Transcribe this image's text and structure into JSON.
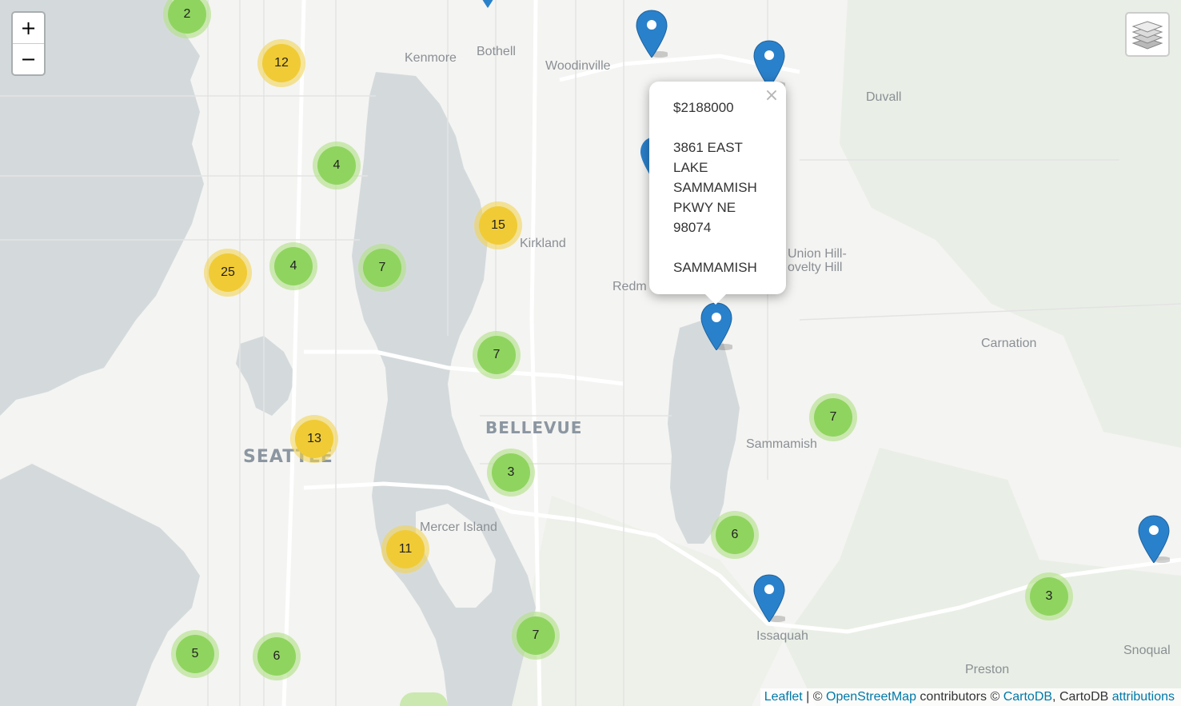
{
  "controls": {
    "zoom_in": "+",
    "zoom_out": "−",
    "layers_icon": "layers-icon"
  },
  "place_labels": {
    "kenmore": "Kenmore",
    "bothell": "Bothell",
    "woodinville": "Woodinville",
    "duvall": "Duvall",
    "kirkland": "Kirkland",
    "redmond": "Redm",
    "union_hill": "Union Hill-",
    "novelty_hill": "ovelty Hill",
    "carnation": "Carnation",
    "bellevue": "BELLEVUE",
    "seattle": "SEATTLE",
    "sammamish": "Sammamish",
    "mercer_island": "Mercer Island",
    "issaquah": "Issaquah",
    "preston": "Preston",
    "snoqualmie": "Snoqual"
  },
  "clusters": [
    {
      "count": "2",
      "level": "green"
    },
    {
      "count": "12",
      "level": "yellow"
    },
    {
      "count": "4",
      "level": "green"
    },
    {
      "count": "15",
      "level": "yellow"
    },
    {
      "count": "25",
      "level": "yellow"
    },
    {
      "count": "4",
      "level": "green"
    },
    {
      "count": "7",
      "level": "green"
    },
    {
      "count": "7",
      "level": "green"
    },
    {
      "count": "7",
      "level": "green"
    },
    {
      "count": "13",
      "level": "yellow"
    },
    {
      "count": "3",
      "level": "green"
    },
    {
      "count": "6",
      "level": "green"
    },
    {
      "count": "11",
      "level": "yellow"
    },
    {
      "count": "3",
      "level": "green"
    },
    {
      "count": "5",
      "level": "green"
    },
    {
      "count": "6",
      "level": "green"
    },
    {
      "count": "7",
      "level": "green"
    }
  ],
  "popup": {
    "price": "$2188000",
    "address_lines": [
      "3861 EAST",
      "LAKE",
      "SAMMAMISH",
      "PKWY NE",
      "98074"
    ],
    "city": "SAMMAMISH",
    "close": "×"
  },
  "attribution": {
    "leaflet": "Leaflet",
    "sep1": " | © ",
    "osm": "OpenStreetMap",
    "contrib": " contributors © ",
    "cartodb": "CartoDB",
    "sep2": ", CartoDB ",
    "attributions": "attributions"
  },
  "colors": {
    "water": "#d4dadc",
    "land": "#f4f4f2",
    "cluster_green": "#8fd45f",
    "cluster_yellow": "#f0cb35",
    "marker_blue": "#2a81cb",
    "link": "#0078a8"
  }
}
